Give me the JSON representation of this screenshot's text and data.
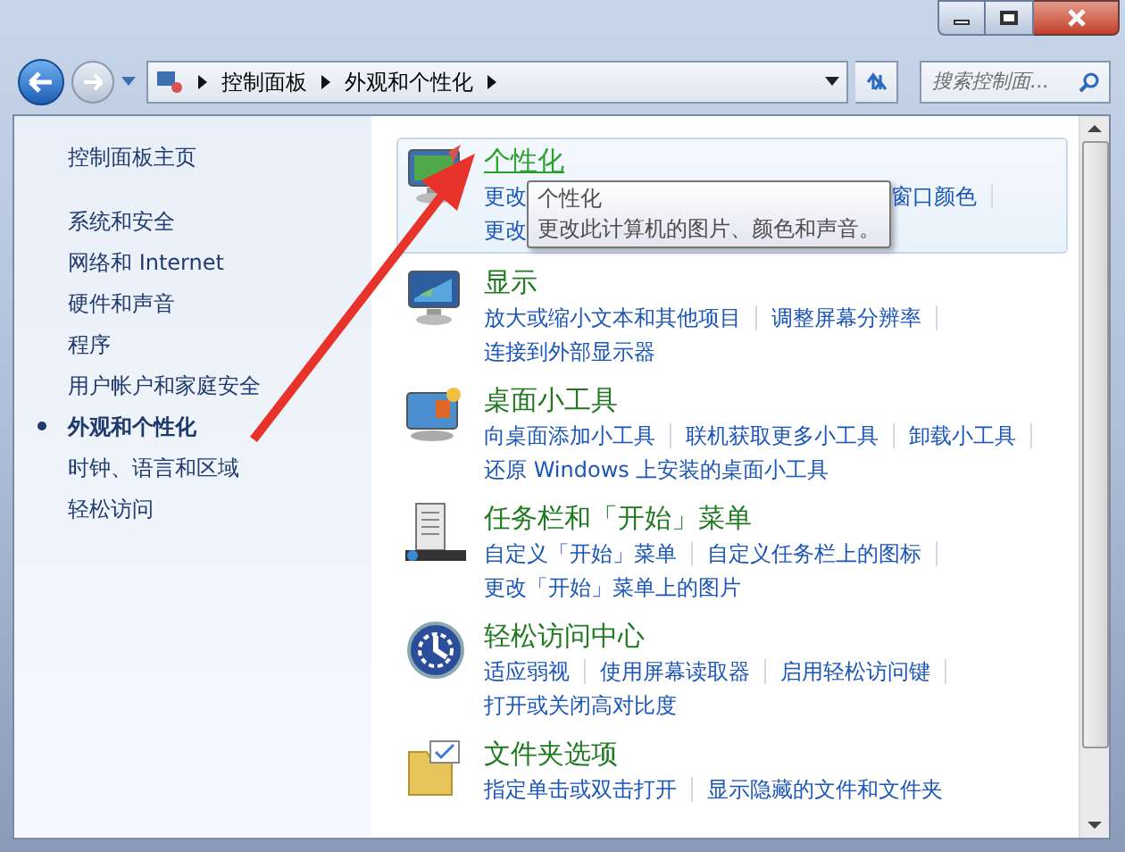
{
  "nav": {
    "breadcrumb": [
      "控制面板",
      "外观和个性化"
    ],
    "search": {
      "placeholder": "搜索控制面..."
    }
  },
  "sidebar": {
    "home": "控制面板主页",
    "items": [
      {
        "label": "系统和安全",
        "selected": false
      },
      {
        "label": "网络和 Internet",
        "selected": false
      },
      {
        "label": "硬件和声音",
        "selected": false
      },
      {
        "label": "程序",
        "selected": false
      },
      {
        "label": "用户帐户和家庭安全",
        "selected": false
      },
      {
        "label": "外观和个性化",
        "selected": true
      },
      {
        "label": "时钟、语言和区域",
        "selected": false
      },
      {
        "label": "轻松访问",
        "selected": false
      }
    ]
  },
  "categories": [
    {
      "kind": "personalize",
      "title": "个性化",
      "hovered": true,
      "links_before_tooltip": [
        "更改",
        "更改"
      ],
      "links_after_tooltip": [
        "窗口颜色"
      ],
      "tooltip": {
        "title": "个性化",
        "text": "更改此计算机的图片、颜色和声音。"
      }
    },
    {
      "kind": "display",
      "title": "显示",
      "hovered": false,
      "link_rows": [
        [
          "放大或缩小文本和其他项目",
          "调整屏幕分辨率"
        ],
        [
          "连接到外部显示器"
        ]
      ]
    },
    {
      "kind": "gadgets",
      "title": "桌面小工具",
      "hovered": false,
      "link_rows": [
        [
          "向桌面添加小工具",
          "联机获取更多小工具",
          "卸载小工具"
        ],
        [
          "还原 Windows 上安装的桌面小工具"
        ]
      ]
    },
    {
      "kind": "taskbar",
      "title": "任务栏和「开始」菜单",
      "hovered": false,
      "link_rows": [
        [
          "自定义「开始」菜单",
          "自定义任务栏上的图标"
        ],
        [
          "更改「开始」菜单上的图片"
        ]
      ]
    },
    {
      "kind": "ease",
      "title": "轻松访问中心",
      "hovered": false,
      "link_rows": [
        [
          "适应弱视",
          "使用屏幕读取器",
          "启用轻松访问键"
        ],
        [
          "打开或关闭高对比度"
        ]
      ]
    },
    {
      "kind": "folder",
      "title": "文件夹选项",
      "hovered": false,
      "link_rows": [
        [
          "指定单击或双击打开",
          "显示隐藏的文件和文件夹"
        ]
      ]
    }
  ]
}
